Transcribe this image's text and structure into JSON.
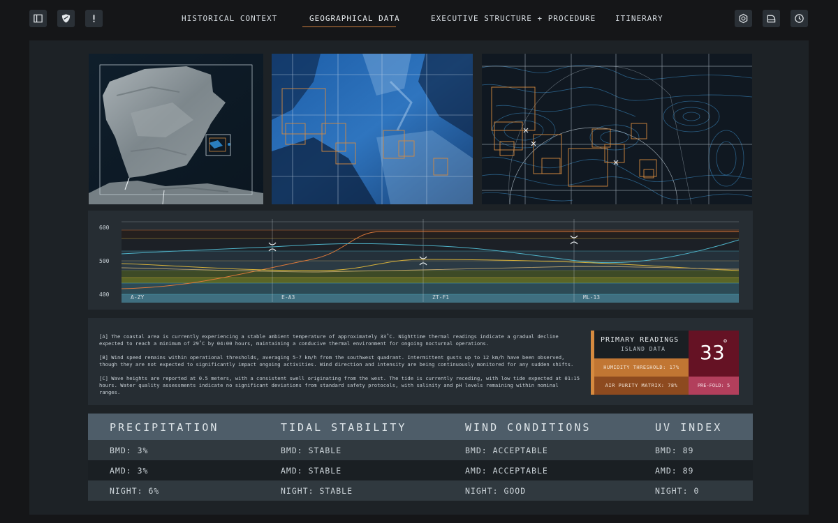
{
  "toolbar_left": [
    {
      "icon": "sidebar-toggle-icon"
    },
    {
      "icon": "shield-icon"
    },
    {
      "icon": "alert-icon"
    }
  ],
  "nav": {
    "tabs": [
      {
        "label": "HISTORICAL CONTEXT"
      },
      {
        "label": "GEOGRAPHICAL DATA",
        "active": true
      },
      {
        "label": "EXECUTIVE STRUCTURE + PROCEDURE"
      },
      {
        "label": "ITINERARY"
      }
    ]
  },
  "toolbar_right": [
    {
      "icon": "hexagon-icon"
    },
    {
      "icon": "document-icon"
    },
    {
      "icon": "clock-icon"
    }
  ],
  "chart_data": {
    "type": "line",
    "y_ticks": [
      400,
      500,
      600
    ],
    "ylim": [
      390,
      620
    ],
    "x_markers": [
      "A-ZY",
      "E-A3",
      "ZT-F1",
      "ML-13"
    ],
    "grid": true,
    "colors": {
      "cyan": "#4fb3c9",
      "orange": "#e07a3a",
      "yellow": "#d7b13a",
      "tan": "#b9a06a"
    }
  },
  "report": {
    "paragraphs": [
      "[A] The coastal area is currently experiencing a stable ambient temperature of approximately 33˚C. Nighttime thermal readings indicate a gradual decline expected to reach a minimum of 29˚C by 04:00 hours, maintaining a conducive thermal environment for ongoing nocturnal operations.",
      "[B] Wind speed remains within operational thresholds, averaging 5-7 km/h from the southwest quadrant. Intermittent gusts up to 12 km/h have been observed, though they are not expected to significantly impact ongoing activities. Wind direction and intensity are being continuously monitored for any sudden shifts.",
      "[C] Wave heights are reported at 0.5 meters, with a consistent swell originating from the west. The tide is currently receding, with low tide expected at 01:15 hours. Water quality assessments indicate no significant deviations from standard safety protocols, with salinity and pH levels remaining within nominal ranges."
    ]
  },
  "readings": {
    "title": "PRIMARY READINGS",
    "subtitle": "ISLAND DATA",
    "temperature": "33",
    "degree": "°",
    "humidity": "HUMIDITY THRESHOLD: 17%",
    "air_purity": "AIR PURITY MATRIX: 78%",
    "prefold": "PRE-FOLD: 5"
  },
  "table": {
    "headers": [
      "PRECIPITATION",
      "TIDAL STABILITY",
      "WIND CONDITIONS",
      "UV INDEX"
    ],
    "rows": [
      [
        "BMD: 3%",
        "BMD: STABLE",
        "BMD: ACCEPTABLE",
        "BMD: 89"
      ],
      [
        "AMD: 3%",
        "AMD: STABLE",
        "AMD: ACCEPTABLE",
        "AMD: 89"
      ],
      [
        "NIGHT: 6%",
        "NIGHT: STABLE",
        "NIGHT: GOOD",
        "NIGHT: 0"
      ]
    ]
  }
}
